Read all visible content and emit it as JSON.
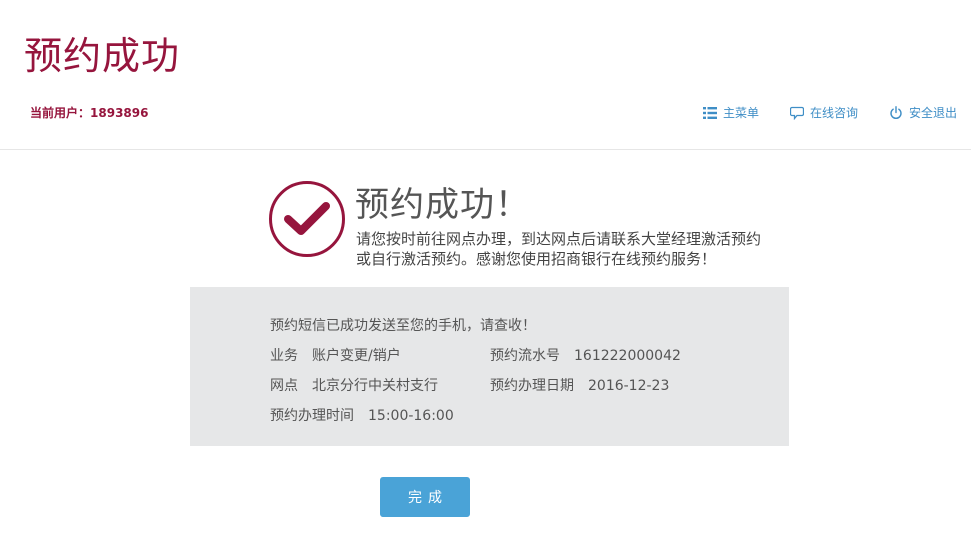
{
  "header": {
    "title": "预约成功",
    "current_user_label": "当前用户：",
    "current_user_value": "1893896",
    "nav": [
      {
        "label": "主菜单",
        "icon": "list-icon"
      },
      {
        "label": "在线咨询",
        "icon": "chat-icon"
      },
      {
        "label": "安全退出",
        "icon": "power-icon"
      }
    ]
  },
  "success": {
    "icon": "checkmark-icon",
    "title": "预约成功！",
    "desc_line1": "请您按时前往网点办理，到达网点后请联系大堂经理激活预约",
    "desc_line2": "或自行激活预约。感谢您使用招商银行在线预约服务！"
  },
  "info": {
    "sms_notice": "预约短信已成功发送至您的手机，请查收！",
    "business_label": "业务",
    "business_value": "账户变更/销户",
    "serial_label": "预约流水号",
    "serial_value": "161222000042",
    "branch_label": "网点",
    "branch_value": "北京分行中关村支行",
    "date_label": "预约办理日期",
    "date_value": "2016-12-23",
    "time_label": "预约办理时间",
    "time_value": "15:00-16:00"
  },
  "actions": {
    "done_label": "完成"
  },
  "colors": {
    "brand": "#96153d",
    "link": "#3f8ec6",
    "button": "#4aa3d7",
    "panel": "#e6e7e8"
  }
}
